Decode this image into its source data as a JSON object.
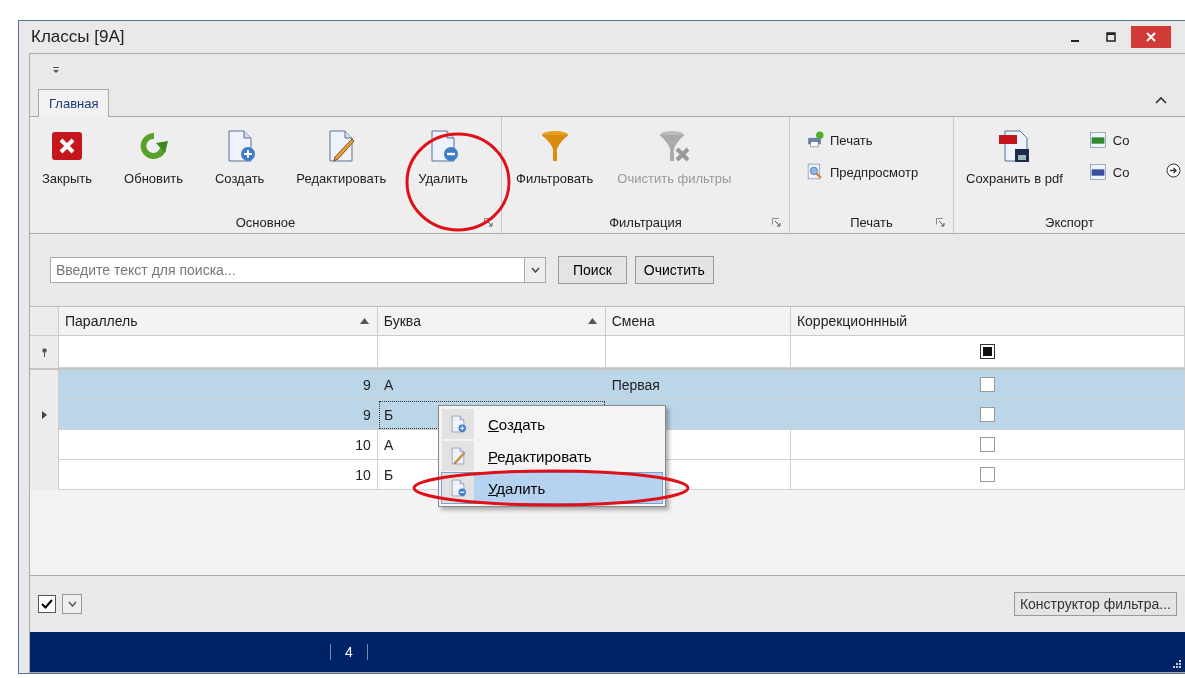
{
  "window": {
    "title": "Классы [9А]"
  },
  "ribbon": {
    "tabs": [
      {
        "label": "Главная",
        "selected": true
      }
    ],
    "groups": [
      {
        "label": "Основное",
        "launcher": true,
        "buttons": [
          {
            "label": "Закрыть",
            "kind": "large",
            "disabled": false
          },
          {
            "label": "Обновить",
            "kind": "large",
            "disabled": false
          },
          {
            "label": "Создать",
            "kind": "large",
            "disabled": false
          },
          {
            "label": "Редактировать",
            "kind": "large",
            "disabled": false
          },
          {
            "label": "Удалить",
            "kind": "large",
            "disabled": false
          }
        ]
      },
      {
        "label": "Фильтрация",
        "launcher": true,
        "buttons": [
          {
            "label": "Фильтровать",
            "kind": "large",
            "disabled": false
          },
          {
            "label": "Очистить фильтры",
            "kind": "large",
            "disabled": true
          }
        ]
      },
      {
        "label": "Печать",
        "launcher": true,
        "buttons": [
          {
            "label": "Печать",
            "kind": "small",
            "disabled": false
          },
          {
            "label": "Предпросмотр",
            "kind": "small",
            "disabled": false
          }
        ]
      },
      {
        "label": "Экспорт",
        "launcher": false,
        "buttons": [
          {
            "label": "Сохранить в pdf",
            "kind": "large",
            "disabled": false
          },
          {
            "label": "Со",
            "kind": "small",
            "disabled": false
          },
          {
            "label": "Со",
            "kind": "small",
            "disabled": false
          }
        ]
      }
    ]
  },
  "search": {
    "placeholder": "Введите текст для поиска...",
    "buttons": [
      "Поиск",
      "Очистить"
    ]
  },
  "grid": {
    "columns": [
      {
        "label": "Параллель",
        "sorted": true
      },
      {
        "label": "Буква",
        "sorted": true
      },
      {
        "label": "Смена",
        "sorted": false
      },
      {
        "label": "Коррекционнный",
        "sorted": false
      }
    ],
    "filter_row": {
      "indeterminate": true
    },
    "rows": [
      {
        "parallel": "9",
        "letter": "А",
        "shift": "Первая",
        "checked": false,
        "selected": true,
        "focused": false
      },
      {
        "parallel": "9",
        "letter": "Б",
        "checked": false,
        "selected": true,
        "focused": true
      },
      {
        "parallel": "10",
        "letter": "А",
        "checked": false,
        "selected": false,
        "focused": false
      },
      {
        "parallel": "10",
        "letter": "Б",
        "checked": false,
        "selected": false,
        "focused": false
      }
    ]
  },
  "context_menu": {
    "items": [
      {
        "label": "Создать",
        "selected": false
      },
      {
        "label": "Редактировать",
        "selected": false
      },
      {
        "label": "Удалить",
        "selected": true
      }
    ]
  },
  "footer": {
    "filter_enabled": true,
    "button": "Конструктор фильтра..."
  },
  "status_bar": {
    "count": "4"
  }
}
